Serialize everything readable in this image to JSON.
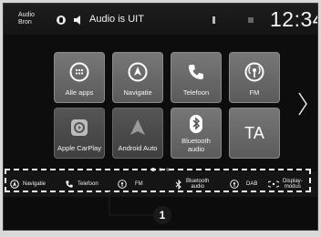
{
  "status_bar": {
    "audio_source": "Audio\nBron",
    "audio_text": "Audio is UIT",
    "clock": "12:34"
  },
  "tiles": [
    {
      "label": "Alle apps",
      "icon": "grid-icon"
    },
    {
      "label": "Navigatie",
      "icon": "navigation-arrow-icon"
    },
    {
      "label": "Telefoon",
      "icon": "phone-icon"
    },
    {
      "label": "FM",
      "icon": "radio-icon"
    },
    {
      "label": "Apple CarPlay",
      "icon": "carplay-icon"
    },
    {
      "label": "Android Auto",
      "icon": "android-auto-icon"
    },
    {
      "label": "Bluetooth\naudio",
      "icon": "bluetooth-icon"
    },
    {
      "label": "TA",
      "icon": "traffic-announcement"
    }
  ],
  "bottom_bar": [
    {
      "label": "Navigatie",
      "icon": "navigation-icon"
    },
    {
      "label": "Telefoon",
      "icon": "phone-icon"
    },
    {
      "label": "FM",
      "icon": "radio-icon"
    },
    {
      "label": "Bluetooth\naudio",
      "icon": "bluetooth-icon"
    },
    {
      "label": "DAB",
      "icon": "radio-icon"
    },
    {
      "label": "Display-\nmodus",
      "icon": "display-mode-icon"
    }
  ],
  "callout": "1"
}
